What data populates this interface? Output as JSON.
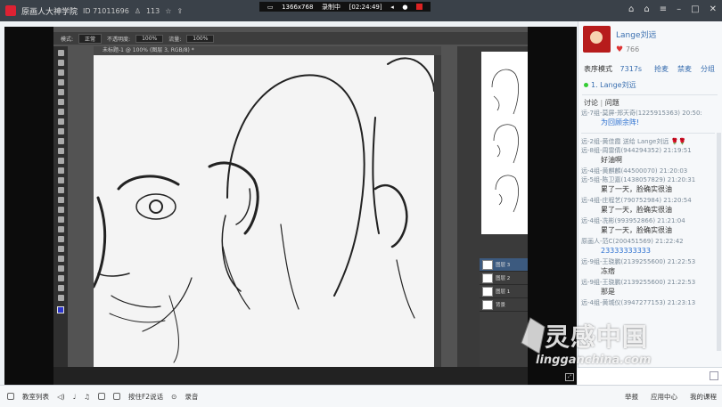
{
  "window": {
    "title": "原画人大神学院",
    "room_id": "ID 71011696",
    "member_count": "113"
  },
  "recording": {
    "resolution": "1366x768",
    "status": "录制中",
    "time": "[02:24:49]"
  },
  "photoshop": {
    "options": [
      "模式:",
      "正常",
      "不透明度:",
      "100%",
      "流量:",
      "100%"
    ],
    "canvas_title": "未标题-1 @ 100% (图层 3, RGB/8) *",
    "layers": [
      "图层 3",
      "图层 2",
      "图层 1",
      "背景"
    ]
  },
  "sidebar": {
    "teacher_name": "Lange刘远",
    "likes": "766",
    "performance_label": "表序模式",
    "performance_value": "7317s",
    "actions": [
      "抢麦",
      "禁麦",
      "分组"
    ],
    "queue_item": "1. Lange刘远",
    "discussion_label": "讨论",
    "question_label": "问题",
    "messages": [
      {
        "meta": "远-7组-莫屏-郑天奇(1225915363) 20:50:",
        "text": "为回顾余阵!",
        "text_blue": true
      },
      {
        "meta": "远-2组-黄佳霞 送给 Lange刘远 🌹🌹",
        "text": "",
        "text_blue": false
      },
      {
        "meta": "远-8组-周雷倩(944294352) 21:19:51",
        "text": "好油啊",
        "text_blue": false
      },
      {
        "meta": "远-4组-黄麒麟(44500070) 21:20:03",
        "text": "",
        "text_blue": false
      },
      {
        "meta": "远-5组-陈卫嘉(1438057829) 21:20:31",
        "text": "累了一天，脸确实很油",
        "text_blue": false
      },
      {
        "meta": "远-4组-庄程艺(790752984) 21:20:54",
        "text": "累了一天，脸确实很油",
        "text_blue": false
      },
      {
        "meta": "远-4组-冼彬(993952866) 21:21:04",
        "text": "累了一天，脸确实很油",
        "text_blue": false
      },
      {
        "meta": "原画人-范C(200451569) 21:22:42",
        "text": "23333333333",
        "text_blue": true
      },
      {
        "meta": "远-9组-王骁鹏(2139255600) 21:22:53",
        "text": "冻痞",
        "text_blue": false
      },
      {
        "meta": "远-9组-王骁鹏(2139255600) 21:22:53",
        "text": "那是",
        "text_blue": false
      },
      {
        "meta": "远-4组-黄城仪(3947277153) 21:23:13",
        "text": "",
        "text_blue": false
      }
    ]
  },
  "bottom": {
    "left_items": [
      "教室列表",
      "按住F2说话",
      "录音"
    ],
    "right_items": [
      "举报",
      "应用中心",
      "我的课程"
    ]
  },
  "watermark": {
    "cn": "灵感中国",
    "en": "lingganchina.com"
  }
}
